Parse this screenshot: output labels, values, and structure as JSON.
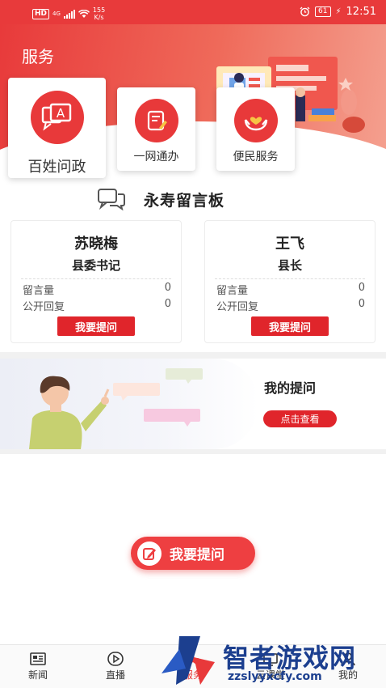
{
  "status_bar": {
    "network_badge": "HD",
    "signal_type": "4G",
    "speed_value": "155",
    "speed_unit": "K/s",
    "battery": "61",
    "time": "12:51"
  },
  "header": {
    "title": "服务"
  },
  "services": [
    {
      "label": "百姓问政",
      "icon": "chat-bubble-a-icon"
    },
    {
      "label": "一网通办",
      "icon": "document-edit-icon"
    },
    {
      "label": "便民服务",
      "icon": "heart-hands-icon"
    }
  ],
  "message_board": {
    "title": "永寿留言板",
    "stat_labels": {
      "messages": "留言量",
      "public_replies": "公开回复"
    },
    "leaders": [
      {
        "name": "苏晓梅",
        "position": "县委书记",
        "messages": "0",
        "public_replies": "0",
        "button": "我要提问"
      },
      {
        "name": "王飞",
        "position": "县长",
        "messages": "0",
        "public_replies": "0",
        "button": "我要提问"
      }
    ]
  },
  "my_questions": {
    "title": "我的提问",
    "button": "点击查看"
  },
  "float_button": {
    "label": "我要提问"
  },
  "tabbar": [
    {
      "label": "新闻",
      "icon": "news-icon"
    },
    {
      "label": "直播",
      "icon": "play-icon"
    },
    {
      "label": "服务",
      "icon": "service-icon"
    },
    {
      "label": "云课堂",
      "icon": "classroom-icon"
    },
    {
      "label": "我的",
      "icon": "profile-icon"
    }
  ],
  "watermark": {
    "brand": "智者游戏网",
    "url": "zzslyyxcfy.com"
  },
  "colors": {
    "primary": "#e8393a",
    "button": "#e0252b",
    "watermark": "#1c3f8f"
  }
}
